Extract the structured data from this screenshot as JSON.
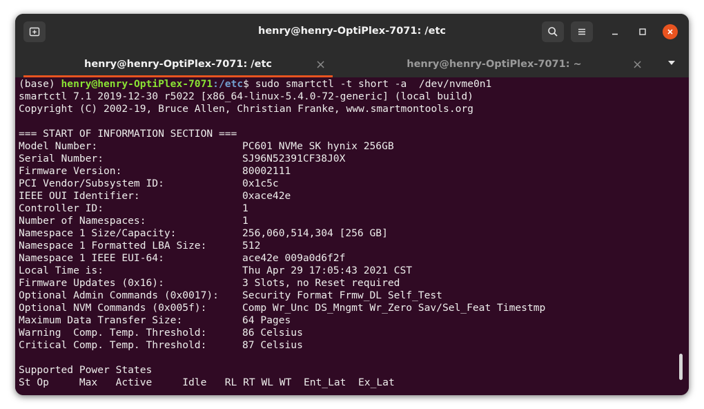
{
  "window": {
    "title": "henry@henry-OptiPlex-7071: /etc"
  },
  "icons": {
    "new_tab": "new-tab-icon",
    "search": "search-icon",
    "menu": "hamburger-menu-icon",
    "minimize": "minimize-icon",
    "maximize": "maximize-icon",
    "close": "close-icon"
  },
  "tabs": [
    {
      "label": "henry@henry-OptiPlex-7071: /etc",
      "close": "×",
      "active": true
    },
    {
      "label": "henry@henry-OptiPlex-7071: ~",
      "close": "×",
      "active": false
    }
  ],
  "colors": {
    "terminal_bg": "#300a24",
    "prompt_user": "#8ae234",
    "prompt_path": "#729fcf",
    "close_button": "#e95420",
    "tab_accent": "#e95420"
  },
  "terminal": {
    "prompt": {
      "env": "(base) ",
      "user": "henry@henry-OptiPlex-7071",
      "path": ":/etc",
      "symbol": "$ ",
      "command": "sudo smartctl -t short -a  /dev/nvme0n1"
    },
    "header_lines": [
      "smartctl 7.1 2019-12-30 r5022 [x86_64-linux-5.4.0-72-generic] (local build)",
      "Copyright (C) 2002-19, Bruce Allen, Christian Franke, www.smartmontools.org"
    ],
    "section_title": "=== START OF INFORMATION SECTION ===",
    "info": [
      {
        "key": "Model Number:",
        "value": "PC601 NVMe SK hynix 256GB"
      },
      {
        "key": "Serial Number:",
        "value": "SJ96N52391CF38J0X"
      },
      {
        "key": "Firmware Version:",
        "value": "80002111"
      },
      {
        "key": "PCI Vendor/Subsystem ID:",
        "value": "0x1c5c"
      },
      {
        "key": "IEEE OUI Identifier:",
        "value": "0xace42e"
      },
      {
        "key": "Controller ID:",
        "value": "1"
      },
      {
        "key": "Number of Namespaces:",
        "value": "1"
      },
      {
        "key": "Namespace 1 Size/Capacity:",
        "value": "256,060,514,304 [256 GB]"
      },
      {
        "key": "Namespace 1 Formatted LBA Size:",
        "value": "512"
      },
      {
        "key": "Namespace 1 IEEE EUI-64:",
        "value": "ace42e 009a0d6f2f"
      },
      {
        "key": "Local Time is:",
        "value": "Thu Apr 29 17:05:43 2021 CST"
      },
      {
        "key": "Firmware Updates (0x16):",
        "value": "3 Slots, no Reset required"
      },
      {
        "key": "Optional Admin Commands (0x0017):",
        "value": "Security Format Frmw_DL Self_Test"
      },
      {
        "key": "Optional NVM Commands (0x005f):",
        "value": "Comp Wr_Unc DS_Mngmt Wr_Zero Sav/Sel_Feat Timestmp"
      },
      {
        "key": "Maximum Data Transfer Size:",
        "value": "64 Pages"
      },
      {
        "key": "Warning  Comp. Temp. Threshold:",
        "value": "86 Celsius"
      },
      {
        "key": "Critical Comp. Temp. Threshold:",
        "value": "87 Celsius"
      }
    ],
    "power_title": "Supported Power States",
    "power_header": "St Op     Max   Active     Idle   RL RT WL WT  Ent_Lat  Ex_Lat"
  }
}
